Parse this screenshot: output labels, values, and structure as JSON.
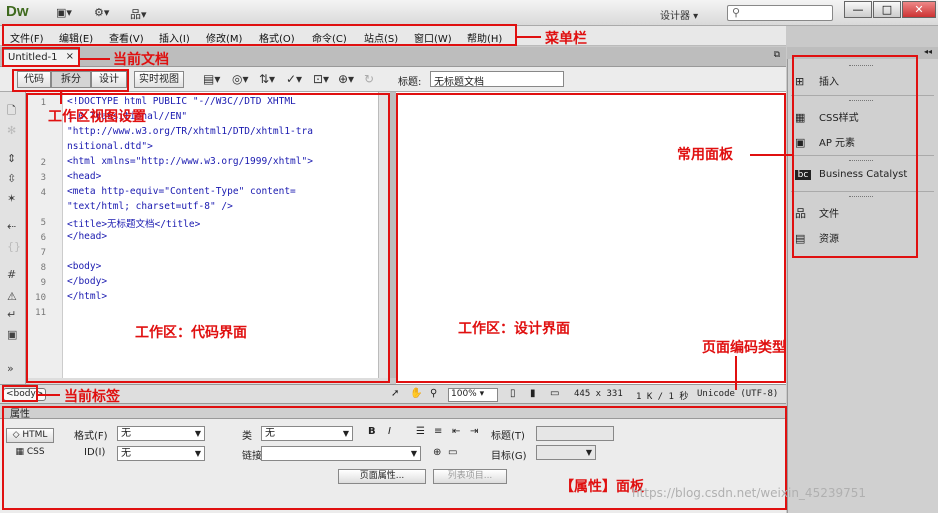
{
  "titlebar": {
    "logo": "Dw",
    "workspace": "设计器",
    "window_buttons": {
      "minimize": "—",
      "maximize": "□",
      "close": "✕"
    }
  },
  "menubar": [
    "文件(F)",
    "编辑(E)",
    "查看(V)",
    "插入(I)",
    "修改(M)",
    "格式(O)",
    "命令(C)",
    "站点(S)",
    "窗口(W)",
    "帮助(H)"
  ],
  "document": {
    "tab_name": "Untitled-1",
    "tab_close": "×"
  },
  "viewbar": {
    "code": "代码",
    "split": "拆分",
    "design": "设计",
    "live": "实时视图",
    "title_label": "标题:",
    "title_value": "无标题文档"
  },
  "code": {
    "line_numbers": [
      "1",
      "",
      "",
      "2",
      "3",
      "4",
      "",
      "5",
      "6",
      "7",
      "8",
      "9",
      "10",
      "11"
    ],
    "lines": [
      "<!DOCTYPE html PUBLIC \"-//W3C//DTD XHTML",
      "1.0 Transitional//EN\"",
      "\"http://www.w3.org/TR/xhtml1/DTD/xhtml1-tra",
      "nsitional.dtd\">",
      "<html xmlns=\"http://www.w3.org/1999/xhtml\">",
      "<head>",
      "<meta http-equiv=\"Content-Type\" content=",
      "\"text/html; charset=utf-8\" />",
      "<title>无标题文档</title>",
      "</head>",
      "",
      "<body>",
      "</body>",
      "</html>"
    ]
  },
  "statusbar": {
    "tag": "<body>",
    "zoom": "100%",
    "size": "445 x 331",
    "file": "1 K / 1 秒",
    "encoding": "Unicode (UTF-8)"
  },
  "properties": {
    "header": "属性",
    "html_btn": "HTML",
    "css_btn": "CSS",
    "format_label": "格式(F)",
    "format_value": "无",
    "class_label": "类",
    "class_value": "无",
    "id_label": "ID(I)",
    "id_value": "无",
    "link_label": "链接(L)",
    "link_value": "",
    "heading_label": "标题(T)",
    "target_label": "目标(G)",
    "bold": "B",
    "italic": "I",
    "page_props": "页面属性...",
    "list_item": "列表项目..."
  },
  "right_panel": {
    "insert": "插入",
    "css_styles": "CSS样式",
    "ap_elements": "AP 元素",
    "business_catalyst": "Business Catalyst",
    "files": "文件",
    "assets": "资源",
    "collapse": "◂◂"
  },
  "annotations": {
    "current_doc": "当前文档",
    "menubar": "菜单栏",
    "view_settings": "工作区视图设置",
    "common_panels": "常用面板",
    "code_area": "工作区：代码界面",
    "design_area": "工作区：设计界面",
    "encoding_type": "页面编码类型",
    "current_tag": "当前标签",
    "properties_panel": "【属性】面板"
  },
  "watermark": "https://blog.csdn.net/weixin_45239751"
}
